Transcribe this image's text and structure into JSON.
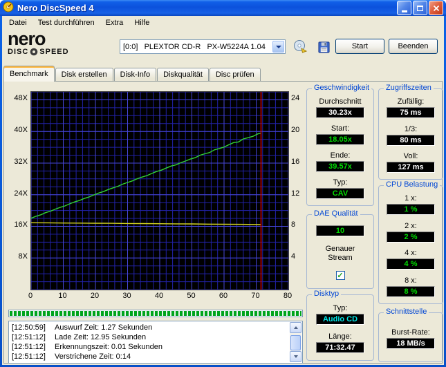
{
  "window": {
    "title": "Nero DiscSpeed 4"
  },
  "menu": {
    "items": [
      "Datei",
      "Test durchführen",
      "Extra",
      "Hilfe"
    ]
  },
  "toolbar": {
    "logo": {
      "name": "nero",
      "sub_left": "DISC",
      "sub_right": "SPEED"
    },
    "drive_select": {
      "value": "[0:0]   PLEXTOR CD-R   PX-W5224A 1.04"
    },
    "start_label": "Start",
    "quit_label": "Beenden"
  },
  "tabs": [
    {
      "label": "Benchmark"
    },
    {
      "label": "Disk erstellen"
    },
    {
      "label": "Disk-Info"
    },
    {
      "label": "Diskqualität"
    },
    {
      "label": "Disc prüfen"
    }
  ],
  "panels": {
    "speed": {
      "title": "Geschwindigkeit",
      "rows": [
        {
          "label": "Durchschnitt",
          "value": "30.23x",
          "color": "#FFFFFF"
        },
        {
          "label": "Start:",
          "value": "18.05x",
          "color": "#00DC00"
        },
        {
          "label": "Ende:",
          "value": "39.57x",
          "color": "#00DC00"
        },
        {
          "label": "Typ:",
          "value": "CAV",
          "color": "#00DC00"
        }
      ]
    },
    "dae": {
      "title": "DAE Qualität",
      "value": "10",
      "value_color": "#00DC00",
      "stream_label": "Genauer Stream",
      "checked": true,
      "checkmark": "✓"
    },
    "disc": {
      "title": "Disktyp",
      "rows": [
        {
          "label": "Typ:",
          "value": "Audio CD",
          "color": "#00E6E6"
        },
        {
          "label": "Länge:",
          "value": "71:32.47",
          "color": "#FFFFFF"
        }
      ]
    },
    "access": {
      "title": "Zugriffszeiten",
      "rows": [
        {
          "label": "Zufällig:",
          "value": "75 ms",
          "color": "#FFFFFF"
        },
        {
          "label": "1/3:",
          "value": "80 ms",
          "color": "#FFFFFF"
        },
        {
          "label": "Voll:",
          "value": "127 ms",
          "color": "#FFFFFF"
        }
      ]
    },
    "cpu": {
      "title": "CPU Belastung",
      "rows": [
        {
          "label": "1 x:",
          "value": "1 %",
          "color": "#00DC00"
        },
        {
          "label": "2 x:",
          "value": "2 %",
          "color": "#00DC00"
        },
        {
          "label": "4 x:",
          "value": "4 %",
          "color": "#00DC00"
        },
        {
          "label": "8 x:",
          "value": "8 %",
          "color": "#00DC00"
        }
      ]
    },
    "iface": {
      "title": "Schnittstelle",
      "rows": [
        {
          "label": "Burst-Rate:",
          "value": "18 MB/s",
          "color": "#FFFFFF"
        }
      ]
    }
  },
  "progress": {
    "percent": 100,
    "color": "#00A41E"
  },
  "log": {
    "entries": [
      {
        "time": "[12:50:59]",
        "text": "Auswurf Zeit: 1.27 Sekunden"
      },
      {
        "time": "[12:51:12]",
        "text": "Lade Zeit: 12.95 Sekunden"
      },
      {
        "time": "[12:51:12]",
        "text": "Erkennungszeit: 0.01 Sekunden"
      },
      {
        "time": "[12:51:12]",
        "text": "Verstrichene Zeit: 0:14"
      }
    ]
  },
  "chart_data": {
    "type": "line",
    "title": "CD read benchmark",
    "x_axis": {
      "min": 0,
      "max": 80,
      "ticks": [
        {
          "value": 0,
          "label": "0"
        },
        {
          "value": 10,
          "label": "10"
        },
        {
          "value": 20,
          "label": "20"
        },
        {
          "value": 30,
          "label": "30"
        },
        {
          "value": 40,
          "label": "40"
        },
        {
          "value": 50,
          "label": "50"
        },
        {
          "value": 60,
          "label": "60"
        },
        {
          "value": 70,
          "label": "70"
        },
        {
          "value": 80,
          "label": "80"
        }
      ]
    },
    "y_left": {
      "min": 0,
      "max": 50,
      "unit": "X",
      "ticks": [
        {
          "value": 48,
          "label": "48X"
        },
        {
          "value": 40,
          "label": "40X"
        },
        {
          "value": 32,
          "label": "32X"
        },
        {
          "value": 24,
          "label": "24X"
        },
        {
          "value": 16,
          "label": "16X"
        },
        {
          "value": 8,
          "label": "8X"
        }
      ]
    },
    "y_right": {
      "min": 0,
      "max": 25,
      "ticks": [
        {
          "value": 24,
          "label": "24"
        },
        {
          "value": 20,
          "label": "20"
        },
        {
          "value": 16,
          "label": "16"
        },
        {
          "value": 12,
          "label": "12"
        },
        {
          "value": 8,
          "label": "8"
        },
        {
          "value": 4,
          "label": "4"
        }
      ]
    },
    "grid": {
      "background": "#000000",
      "minor": "#2222A8",
      "major": "#4747D8",
      "x_minor_step": 2,
      "y_minor_step": 2
    },
    "series": [
      {
        "name": "read-speed",
        "axis": "left",
        "color": "#32D232",
        "x": [
          0,
          1.5,
          3,
          4.5,
          6,
          7.5,
          9,
          10.5,
          12,
          13.5,
          15,
          16.5,
          18,
          19.5,
          21,
          22.5,
          24,
          25.5,
          27,
          28.5,
          30,
          31.5,
          33,
          34.5,
          36,
          37.5,
          39,
          40.5,
          42,
          43.5,
          45,
          46.5,
          48,
          49.5,
          51,
          52.5,
          54,
          55.5,
          57,
          58.5,
          60,
          61.5,
          63,
          64.5,
          66,
          67.5,
          69,
          70.5,
          71.5
        ],
        "y": [
          18.05,
          18.55,
          18.91,
          19.46,
          19.83,
          20.35,
          20.78,
          21.16,
          21.69,
          22.17,
          22.54,
          23.05,
          23.42,
          23.94,
          24.42,
          24.79,
          25.31,
          25.73,
          26.13,
          26.67,
          27.1,
          27.5,
          28.04,
          28.46,
          28.83,
          29.37,
          29.86,
          30.21,
          30.74,
          31.24,
          31.53,
          32.08,
          32.51,
          33.01,
          33.36,
          33.96,
          34.35,
          34.67,
          35.35,
          35.69,
          36.05,
          36.65,
          37.18,
          37.35,
          38.11,
          38.42,
          38.77,
          39.38,
          39.57
        ]
      },
      {
        "name": "rotation-speed",
        "axis": "right",
        "color": "#D8D820",
        "x": [
          0,
          5,
          10,
          15,
          20,
          25,
          30,
          35,
          40,
          45,
          50,
          55,
          60,
          65,
          70,
          71.5
        ],
        "y": [
          8.45,
          8.44,
          8.42,
          8.41,
          8.39,
          8.38,
          8.36,
          8.35,
          8.33,
          8.31,
          8.3,
          8.28,
          8.27,
          8.25,
          8.23,
          8.22
        ]
      }
    ],
    "end_marker": {
      "x": 71.5,
      "color": "#C80000"
    }
  }
}
